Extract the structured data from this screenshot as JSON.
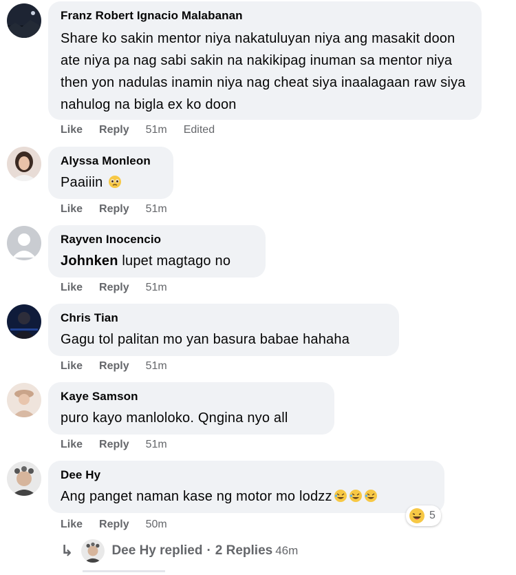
{
  "colors": {
    "bubble": "#f0f2f5",
    "meta": "#65676b",
    "text": "#050505"
  },
  "comments": [
    {
      "author": "Franz Robert Ignacio Malabanan",
      "text": "Share ko sakin mentor niya nakatuluyan niya ang masakit doon ate niya pa nag sabi sakin na nakikipag inuman sa mentor niya then yon nadulas inamin niya nag cheat siya inaalagaan raw siya nahulog na bigla ex ko doon",
      "like": "Like",
      "reply": "Reply",
      "time": "51m",
      "edited": "Edited",
      "avatar_icon": "night-landscape-avatar"
    },
    {
      "author": "Alyssa Monleon",
      "text": "Paaiiin",
      "emoji": "pleading-face-emoji",
      "like": "Like",
      "reply": "Reply",
      "time": "51m",
      "avatar_icon": "woman-portrait-avatar"
    },
    {
      "author": "Rayven Inocencio",
      "mention": "Johnken",
      "text": " lupet magtago no",
      "like": "Like",
      "reply": "Reply",
      "time": "51m",
      "avatar_icon": "default-user-avatar"
    },
    {
      "author": "Chris Tian",
      "text": "Gagu tol palitan mo yan basura babae hahaha",
      "like": "Like",
      "reply": "Reply",
      "time": "51m",
      "avatar_icon": "dark-person-avatar"
    },
    {
      "author": "Kaye Samson",
      "text": "puro kayo manloloko. Qngina nyo all",
      "like": "Like",
      "reply": "Reply",
      "time": "51m",
      "avatar_icon": "woman-hat-avatar"
    },
    {
      "author": "Dee Hy",
      "text": "Ang panget naman kase ng motor mo lodzz",
      "emoji": "rolling-laughing-emoji-x3",
      "like": "Like",
      "reply": "Reply",
      "time": "50m",
      "reaction_count": "5",
      "reaction_icon": "haha-reaction-icon",
      "avatar_icon": "man-flower-crown-avatar"
    }
  ],
  "replies_row": {
    "author": "Dee Hy",
    "label": "Dee Hy replied",
    "dot": "·",
    "count_label": "2 Replies",
    "time": "46m"
  }
}
